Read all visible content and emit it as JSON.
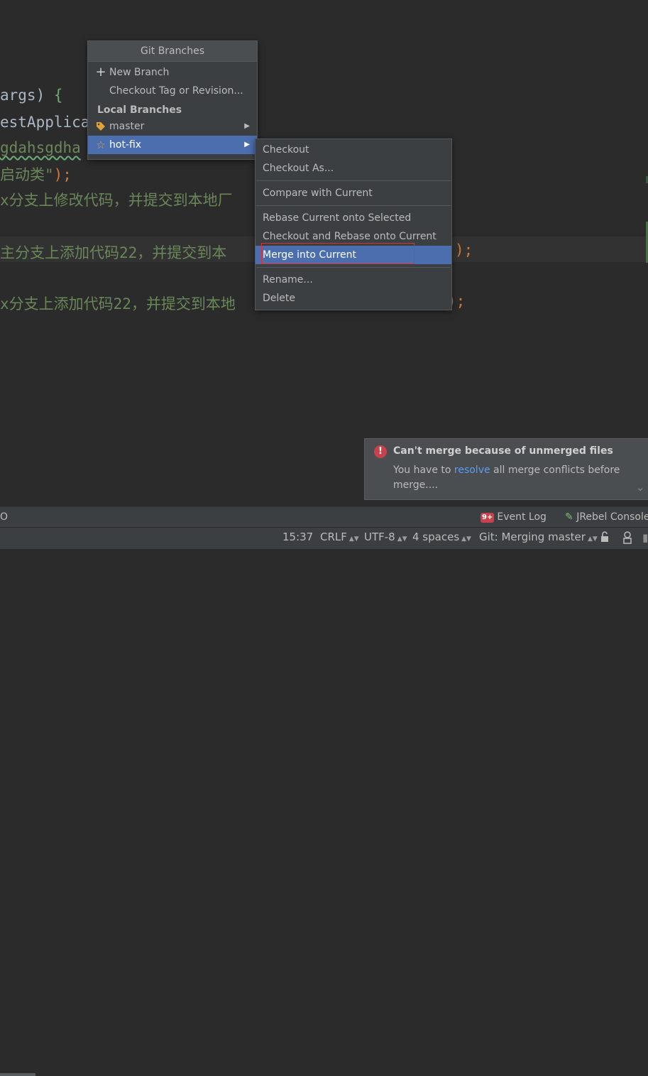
{
  "editor": {
    "lines": [
      {
        "text_a": " args",
        "text_b": ") ",
        "text_c": "{"
      },
      {
        "text": "estApplicat"
      },
      {
        "text": "gdahsgdha"
      },
      {
        "text_a": "启动类\"",
        "text_b": ");"
      },
      {
        "text": "x分支上修改代码，并提交到本地厂"
      },
      {
        "text_a": "主分支上添加代码22，并提交到本",
        "text_b": ");"
      },
      {
        "text_a": "x分支上添加代码22，并提交到本地",
        "text_b": ");"
      }
    ]
  },
  "git_branches_popup": {
    "title": "Git Branches",
    "items": [
      {
        "icon": "+",
        "label": "New Branch"
      },
      {
        "label": "Checkout Tag or Revision..."
      }
    ],
    "local_branches_header": "Local Branches",
    "branches": [
      {
        "icon": "tag-icon",
        "label": "master"
      },
      {
        "icon": "star-icon",
        "label": "hot-fix"
      }
    ]
  },
  "branch_submenu": {
    "items": [
      "Checkout",
      "Checkout As...",
      "Compare with Current",
      "Rebase Current onto Selected",
      "Checkout and Rebase onto Current",
      "Merge into Current",
      "Rename...",
      "Delete"
    ]
  },
  "notification": {
    "title": "Can't merge because of unmerged files",
    "body_prefix": "You have to ",
    "link": "resolve",
    "body_suffix": " all merge conflicts before merge...."
  },
  "tool_windows": {
    "left_fragment": "O",
    "event_log_badge": "9+",
    "event_log": "Event Log",
    "jrebel": "JRebel Console"
  },
  "status_bar": {
    "position": "15:37",
    "line_separator": "CRLF",
    "encoding": "UTF-8",
    "indent": "4 spaces",
    "vcs": "Git: Merging master"
  },
  "colors": {
    "accent_selected": "#4b6eaf",
    "error": "#c7424c",
    "link": "#589df6",
    "highlight_box": "#e03030"
  }
}
